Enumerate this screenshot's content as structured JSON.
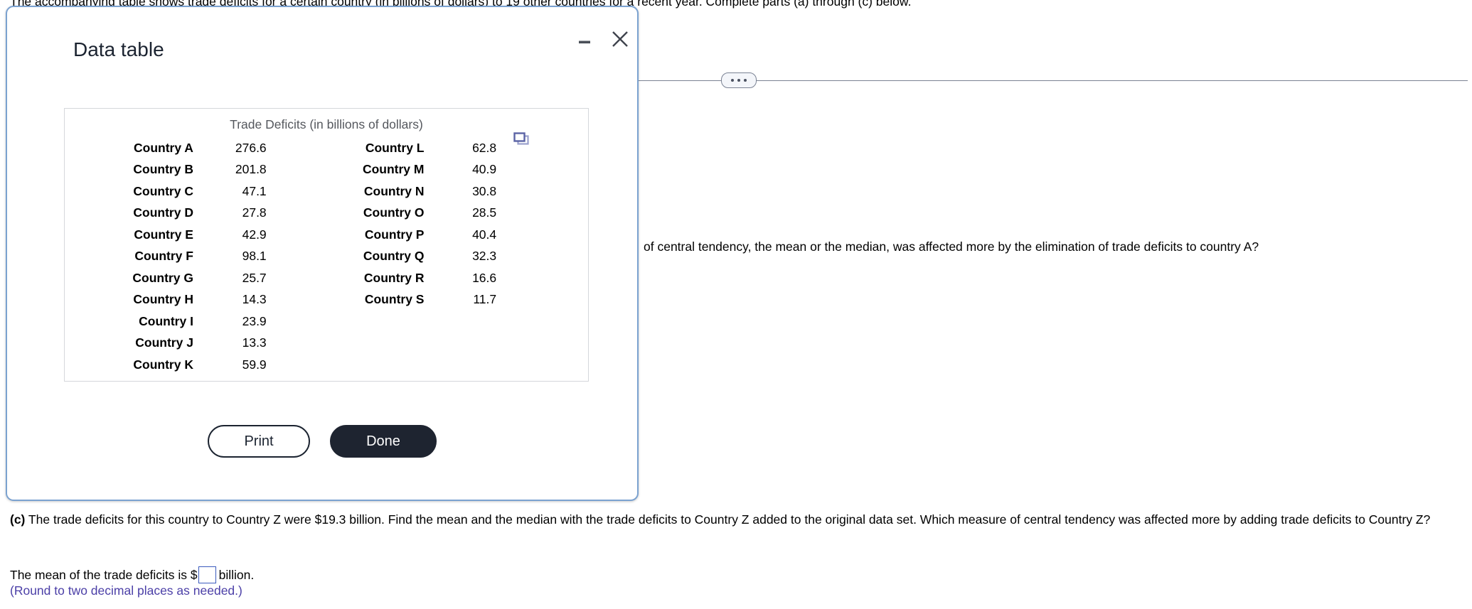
{
  "page": {
    "intro": "The accompanying table shows trade deficits for a certain country (in billions of dollars) to 19 other countries for a recent year. Complete parts (a) through (c) below.",
    "part_b_fragment": "of central tendency, the mean or the median, was affected more by the elimination of trade deficits to country A?",
    "part_c_label": "(c)",
    "part_c_text": " The trade deficits for this country to Country Z were $19.3 billion. Find the mean and the median with the trade deficits to Country Z added to the original data set. Which measure of central tendency was affected more by adding trade deficits to Country Z?",
    "answer_prefix": "The mean of the trade deficits is $",
    "answer_value": "",
    "answer_suffix": "billion.",
    "round_note": "(Round to two decimal places as needed.)",
    "divider_dots_icon": "ellipsis-icon"
  },
  "dialog": {
    "title": "Data table",
    "minimize_icon": "minimize-icon",
    "close_icon": "close-icon",
    "copy_icon": "copy-icon",
    "print_label": "Print",
    "done_label": "Done",
    "table": {
      "caption": "Trade Deficits (in billions of dollars)",
      "rows": [
        {
          "name1": "Country A",
          "val1": "276.6",
          "name2": "Country L",
          "val2": "62.8"
        },
        {
          "name1": "Country B",
          "val1": "201.8",
          "name2": "Country M",
          "val2": "40.9"
        },
        {
          "name1": "Country C",
          "val1": "47.1",
          "name2": "Country N",
          "val2": "30.8"
        },
        {
          "name1": "Country D",
          "val1": "27.8",
          "name2": "Country O",
          "val2": "28.5"
        },
        {
          "name1": "Country E",
          "val1": "42.9",
          "name2": "Country P",
          "val2": "40.4"
        },
        {
          "name1": "Country F",
          "val1": "98.1",
          "name2": "Country Q",
          "val2": "32.3"
        },
        {
          "name1": "Country G",
          "val1": "25.7",
          "name2": "Country R",
          "val2": "16.6"
        },
        {
          "name1": "Country H",
          "val1": "14.3",
          "name2": "Country S",
          "val2": "11.7"
        },
        {
          "name1": "Country I",
          "val1": "23.9",
          "name2": "",
          "val2": ""
        },
        {
          "name1": "Country J",
          "val1": "13.3",
          "name2": "",
          "val2": ""
        },
        {
          "name1": "Country K",
          "val1": "59.9",
          "name2": "",
          "val2": ""
        }
      ]
    }
  },
  "colors": {
    "dialog_border": "#7ba2d0",
    "accent_dark": "#1e2430",
    "hint_purple": "#4b3fa7",
    "input_border": "#3b5bbd",
    "copy_icon": "#5b63a5"
  }
}
